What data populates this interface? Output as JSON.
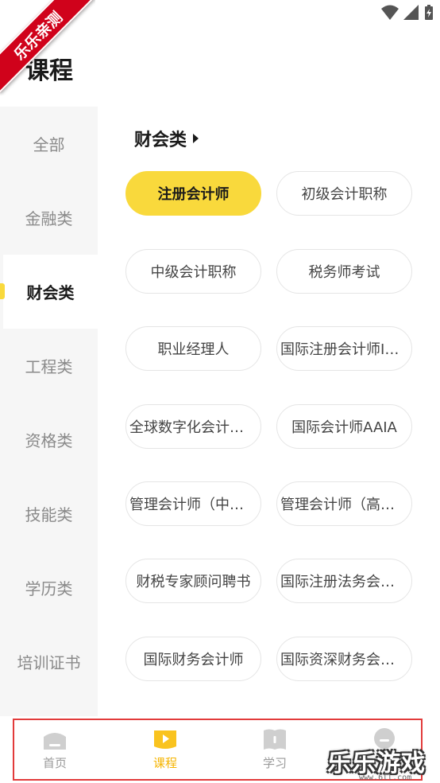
{
  "watermark": {
    "ribbon_text": "乐乐亲测",
    "brand_text": "乐乐游戏",
    "brand_url": "www.6ll.com"
  },
  "page_title": "课程",
  "sidebar": {
    "items": [
      {
        "label": "全部"
      },
      {
        "label": "金融类"
      },
      {
        "label": "财会类",
        "active": true
      },
      {
        "label": "工程类"
      },
      {
        "label": "资格类"
      },
      {
        "label": "技能类"
      },
      {
        "label": "学历类"
      },
      {
        "label": "培训证书"
      }
    ]
  },
  "section": {
    "title": "财会类",
    "chips": [
      {
        "label": "注册会计师",
        "selected": true
      },
      {
        "label": "初级会计职称"
      },
      {
        "label": "中级会计职称"
      },
      {
        "label": "税务师考试"
      },
      {
        "label": "职业经理人"
      },
      {
        "label": "国际注册会计师IC..."
      },
      {
        "label": "全球数字化会计师..."
      },
      {
        "label": "国际会计师AAIA"
      },
      {
        "label": "管理会计师（中级..."
      },
      {
        "label": "管理会计师（高级..."
      },
      {
        "label": "财税专家顾问聘书"
      },
      {
        "label": "国际注册法务会计..."
      },
      {
        "label": "国际财务会计师"
      },
      {
        "label": "国际资深财务会计..."
      }
    ]
  },
  "bottom_nav": {
    "items": [
      {
        "label": "首页",
        "icon": "home-icon"
      },
      {
        "label": "课程",
        "icon": "course-play-icon",
        "active": true
      },
      {
        "label": "学习",
        "icon": "book-icon"
      },
      {
        "label": "",
        "icon": "profile-icon"
      }
    ]
  },
  "colors": {
    "accent": "#f9d93c",
    "active_nav": "#f5b400",
    "highlight_box": "#e23b3b",
    "ribbon": "#d0021b"
  }
}
